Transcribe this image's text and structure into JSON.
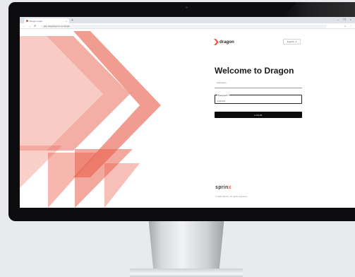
{
  "browser": {
    "tab_title": "Dragon Login",
    "tab_close": "×",
    "new_tab": "+",
    "window_controls": [
      "–",
      "❐",
      "×"
    ],
    "nav_back": "←",
    "nav_forward": "→",
    "nav_reload": "⟳",
    "url": "app.dragonsprinx.com/login",
    "toolbar_icons": [
      "☆",
      "⋮"
    ]
  },
  "brand": {
    "name": "dragon",
    "accent_color": "#e8604c"
  },
  "language": {
    "label": "English",
    "chevron": "▾"
  },
  "login": {
    "title": "Welcome to Dragon",
    "username_label": "Username",
    "password_label": "Password *",
    "password_value": "••••••",
    "button_label": "LOGIN"
  },
  "footer": {
    "logo_text_main": "sprin",
    "logo_text_accent": "x",
    "copyright": "© 2021 Sprinx. All rights reserved."
  }
}
